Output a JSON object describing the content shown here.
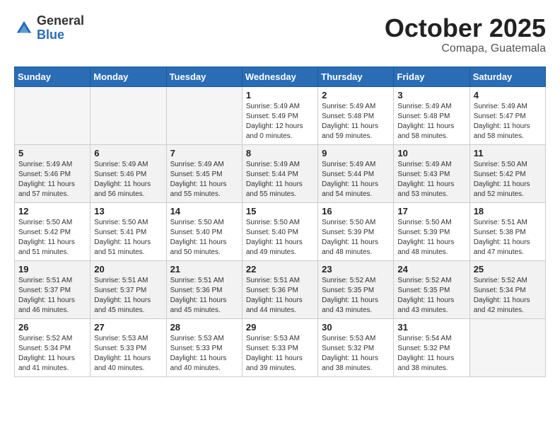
{
  "logo": {
    "general": "General",
    "blue": "Blue"
  },
  "title": "October 2025",
  "location": "Comapa, Guatemala",
  "weekdays": [
    "Sunday",
    "Monday",
    "Tuesday",
    "Wednesday",
    "Thursday",
    "Friday",
    "Saturday"
  ],
  "weeks": [
    [
      {
        "day": "",
        "sunrise": "",
        "sunset": "",
        "daylight": ""
      },
      {
        "day": "",
        "sunrise": "",
        "sunset": "",
        "daylight": ""
      },
      {
        "day": "",
        "sunrise": "",
        "sunset": "",
        "daylight": ""
      },
      {
        "day": "1",
        "sunrise": "Sunrise: 5:49 AM",
        "sunset": "Sunset: 5:49 PM",
        "daylight": "Daylight: 12 hours and 0 minutes."
      },
      {
        "day": "2",
        "sunrise": "Sunrise: 5:49 AM",
        "sunset": "Sunset: 5:48 PM",
        "daylight": "Daylight: 11 hours and 59 minutes."
      },
      {
        "day": "3",
        "sunrise": "Sunrise: 5:49 AM",
        "sunset": "Sunset: 5:48 PM",
        "daylight": "Daylight: 11 hours and 58 minutes."
      },
      {
        "day": "4",
        "sunrise": "Sunrise: 5:49 AM",
        "sunset": "Sunset: 5:47 PM",
        "daylight": "Daylight: 11 hours and 58 minutes."
      }
    ],
    [
      {
        "day": "5",
        "sunrise": "Sunrise: 5:49 AM",
        "sunset": "Sunset: 5:46 PM",
        "daylight": "Daylight: 11 hours and 57 minutes."
      },
      {
        "day": "6",
        "sunrise": "Sunrise: 5:49 AM",
        "sunset": "Sunset: 5:46 PM",
        "daylight": "Daylight: 11 hours and 56 minutes."
      },
      {
        "day": "7",
        "sunrise": "Sunrise: 5:49 AM",
        "sunset": "Sunset: 5:45 PM",
        "daylight": "Daylight: 11 hours and 55 minutes."
      },
      {
        "day": "8",
        "sunrise": "Sunrise: 5:49 AM",
        "sunset": "Sunset: 5:44 PM",
        "daylight": "Daylight: 11 hours and 55 minutes."
      },
      {
        "day": "9",
        "sunrise": "Sunrise: 5:49 AM",
        "sunset": "Sunset: 5:44 PM",
        "daylight": "Daylight: 11 hours and 54 minutes."
      },
      {
        "day": "10",
        "sunrise": "Sunrise: 5:49 AM",
        "sunset": "Sunset: 5:43 PM",
        "daylight": "Daylight: 11 hours and 53 minutes."
      },
      {
        "day": "11",
        "sunrise": "Sunrise: 5:50 AM",
        "sunset": "Sunset: 5:42 PM",
        "daylight": "Daylight: 11 hours and 52 minutes."
      }
    ],
    [
      {
        "day": "12",
        "sunrise": "Sunrise: 5:50 AM",
        "sunset": "Sunset: 5:42 PM",
        "daylight": "Daylight: 11 hours and 51 minutes."
      },
      {
        "day": "13",
        "sunrise": "Sunrise: 5:50 AM",
        "sunset": "Sunset: 5:41 PM",
        "daylight": "Daylight: 11 hours and 51 minutes."
      },
      {
        "day": "14",
        "sunrise": "Sunrise: 5:50 AM",
        "sunset": "Sunset: 5:40 PM",
        "daylight": "Daylight: 11 hours and 50 minutes."
      },
      {
        "day": "15",
        "sunrise": "Sunrise: 5:50 AM",
        "sunset": "Sunset: 5:40 PM",
        "daylight": "Daylight: 11 hours and 49 minutes."
      },
      {
        "day": "16",
        "sunrise": "Sunrise: 5:50 AM",
        "sunset": "Sunset: 5:39 PM",
        "daylight": "Daylight: 11 hours and 48 minutes."
      },
      {
        "day": "17",
        "sunrise": "Sunrise: 5:50 AM",
        "sunset": "Sunset: 5:39 PM",
        "daylight": "Daylight: 11 hours and 48 minutes."
      },
      {
        "day": "18",
        "sunrise": "Sunrise: 5:51 AM",
        "sunset": "Sunset: 5:38 PM",
        "daylight": "Daylight: 11 hours and 47 minutes."
      }
    ],
    [
      {
        "day": "19",
        "sunrise": "Sunrise: 5:51 AM",
        "sunset": "Sunset: 5:37 PM",
        "daylight": "Daylight: 11 hours and 46 minutes."
      },
      {
        "day": "20",
        "sunrise": "Sunrise: 5:51 AM",
        "sunset": "Sunset: 5:37 PM",
        "daylight": "Daylight: 11 hours and 45 minutes."
      },
      {
        "day": "21",
        "sunrise": "Sunrise: 5:51 AM",
        "sunset": "Sunset: 5:36 PM",
        "daylight": "Daylight: 11 hours and 45 minutes."
      },
      {
        "day": "22",
        "sunrise": "Sunrise: 5:51 AM",
        "sunset": "Sunset: 5:36 PM",
        "daylight": "Daylight: 11 hours and 44 minutes."
      },
      {
        "day": "23",
        "sunrise": "Sunrise: 5:52 AM",
        "sunset": "Sunset: 5:35 PM",
        "daylight": "Daylight: 11 hours and 43 minutes."
      },
      {
        "day": "24",
        "sunrise": "Sunrise: 5:52 AM",
        "sunset": "Sunset: 5:35 PM",
        "daylight": "Daylight: 11 hours and 43 minutes."
      },
      {
        "day": "25",
        "sunrise": "Sunrise: 5:52 AM",
        "sunset": "Sunset: 5:34 PM",
        "daylight": "Daylight: 11 hours and 42 minutes."
      }
    ],
    [
      {
        "day": "26",
        "sunrise": "Sunrise: 5:52 AM",
        "sunset": "Sunset: 5:34 PM",
        "daylight": "Daylight: 11 hours and 41 minutes."
      },
      {
        "day": "27",
        "sunrise": "Sunrise: 5:53 AM",
        "sunset": "Sunset: 5:33 PM",
        "daylight": "Daylight: 11 hours and 40 minutes."
      },
      {
        "day": "28",
        "sunrise": "Sunrise: 5:53 AM",
        "sunset": "Sunset: 5:33 PM",
        "daylight": "Daylight: 11 hours and 40 minutes."
      },
      {
        "day": "29",
        "sunrise": "Sunrise: 5:53 AM",
        "sunset": "Sunset: 5:33 PM",
        "daylight": "Daylight: 11 hours and 39 minutes."
      },
      {
        "day": "30",
        "sunrise": "Sunrise: 5:53 AM",
        "sunset": "Sunset: 5:32 PM",
        "daylight": "Daylight: 11 hours and 38 minutes."
      },
      {
        "day": "31",
        "sunrise": "Sunrise: 5:54 AM",
        "sunset": "Sunset: 5:32 PM",
        "daylight": "Daylight: 11 hours and 38 minutes."
      },
      {
        "day": "",
        "sunrise": "",
        "sunset": "",
        "daylight": ""
      }
    ]
  ]
}
